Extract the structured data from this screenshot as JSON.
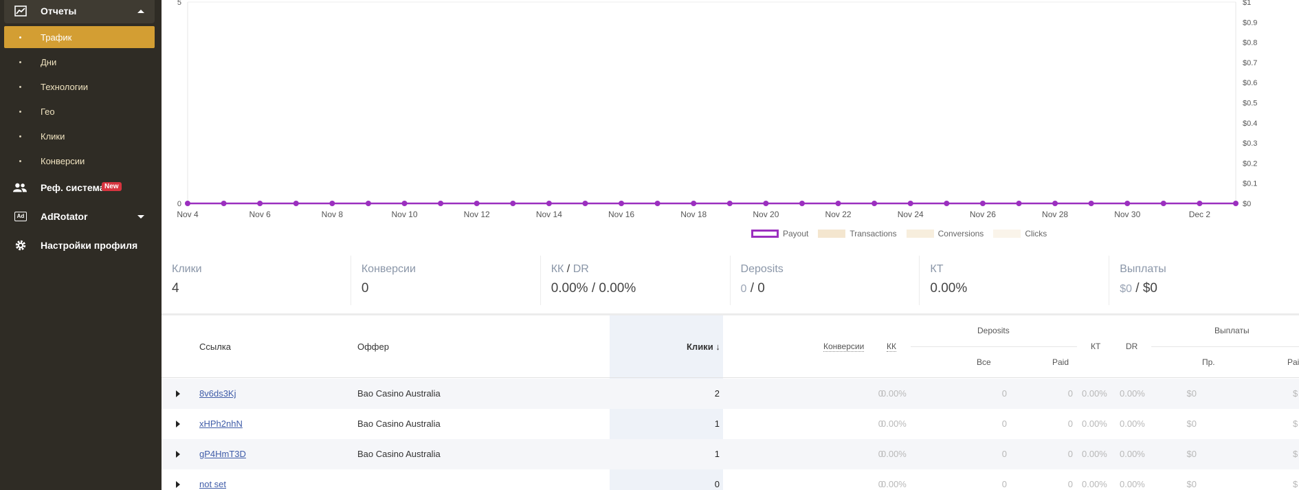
{
  "sidebar": {
    "reports_label": "Отчеты",
    "subitems": [
      "Трафик",
      "Дни",
      "Технологии",
      "Гео",
      "Клики",
      "Конверсии"
    ],
    "ref_label": "Реф. система",
    "ref_badge": "New",
    "adrotator_label": "AdRotator",
    "adrotator_icon_text": "Ad",
    "profile_label": "Настройки профиля"
  },
  "chart_data": {
    "type": "line",
    "x": [
      "Nov 4",
      "Nov 5",
      "Nov 6",
      "Nov 7",
      "Nov 8",
      "Nov 9",
      "Nov 10",
      "Nov 11",
      "Nov 12",
      "Nov 13",
      "Nov 14",
      "Nov 15",
      "Nov 16",
      "Nov 17",
      "Nov 18",
      "Nov 19",
      "Nov 20",
      "Nov 21",
      "Nov 22",
      "Nov 23",
      "Nov 24",
      "Nov 25",
      "Nov 26",
      "Nov 27",
      "Nov 28",
      "Nov 29",
      "Nov 30",
      "Dec 1",
      "Dec 2",
      "Dec 3"
    ],
    "x_tick_labels": [
      "Nov 4",
      "Nov 6",
      "Nov 8",
      "Nov 10",
      "Nov 12",
      "Nov 14",
      "Nov 16",
      "Nov 18",
      "Nov 20",
      "Nov 22",
      "Nov 24",
      "Nov 26",
      "Nov 28",
      "Nov 30",
      "Dec 2"
    ],
    "series": [
      {
        "name": "Payout",
        "values": [
          0,
          0,
          0,
          0,
          0,
          0,
          0,
          0,
          0,
          0,
          0,
          0,
          0,
          0,
          0,
          0,
          0,
          0,
          0,
          0,
          0,
          0,
          0,
          0,
          0,
          0,
          0,
          0,
          0,
          0
        ]
      },
      {
        "name": "Transactions",
        "values": [
          0,
          0,
          0,
          0,
          0,
          0,
          0,
          0,
          0,
          0,
          0,
          0,
          0,
          0,
          0,
          0,
          0,
          0,
          0,
          0,
          0,
          0,
          0,
          0,
          0,
          0,
          0,
          0,
          0,
          0
        ]
      },
      {
        "name": "Conversions",
        "values": [
          0,
          0,
          0,
          0,
          0,
          0,
          0,
          0,
          0,
          0,
          0,
          0,
          0,
          0,
          0,
          0,
          0,
          0,
          0,
          0,
          0,
          0,
          0,
          0,
          0,
          0,
          0,
          0,
          0,
          0
        ]
      },
      {
        "name": "Clicks",
        "values": [
          0,
          0,
          0,
          0,
          0,
          0,
          0,
          0,
          0,
          0,
          0,
          0,
          0,
          0,
          0,
          0,
          0,
          0,
          0,
          0,
          0,
          0,
          0,
          0,
          0,
          0,
          0,
          0,
          0,
          0
        ]
      }
    ],
    "left_axis_ticks": [
      "5",
      "0"
    ],
    "right_axis_ticks": [
      "$1",
      "$0.9",
      "$0.8",
      "$0.7",
      "$0.6",
      "$0.5",
      "$0.4",
      "$0.3",
      "$0.2",
      "$0.1",
      "$0"
    ],
    "ylim_left": [
      0,
      5
    ],
    "ylim_right": [
      0,
      1
    ],
    "legend_position": "bottom",
    "colors": {
      "payout": "#9b2fbf",
      "transactions": "#f4e6cf",
      "conversions": "#f7eedd",
      "clicks": "#faf4ea"
    }
  },
  "stats": [
    {
      "label": "Клики",
      "value": "4"
    },
    {
      "label": "Конверсии",
      "value": "0"
    },
    {
      "label_a": "КК",
      "label_sep": "/",
      "label_b": "DR",
      "value": "0.00% / 0.00%"
    },
    {
      "label": "Deposits",
      "value_muted": "0",
      "value_rest": "/ 0"
    },
    {
      "label": "КТ",
      "value": "0.00%"
    },
    {
      "label": "Выплаты",
      "value_muted": "$0",
      "value_rest": "/ $0"
    }
  ],
  "table": {
    "headers": {
      "link": "Ссылка",
      "offer": "Оффер",
      "clicks": "Клики ↓",
      "conversions": "Конверсии",
      "kk": "КК",
      "deposits": "Deposits",
      "deposits_all": "Все",
      "deposits_paid": "Paid",
      "kt": "КТ",
      "dr": "DR",
      "payouts": "Выплаты",
      "payouts_pr": "Пр.",
      "payouts_paid": "Pai"
    },
    "rows": [
      {
        "link": "8v6ds3Kj",
        "offer": "Bao Casino Australia",
        "clicks": "2",
        "conv": "0",
        "kk": "0.00%",
        "all": "0",
        "paid": "0",
        "kt": "0.00%",
        "dr": "0.00%",
        "pr": "$0",
        "pay_paid": "$"
      },
      {
        "link": "xHPh2nhN",
        "offer": "Bao Casino Australia",
        "clicks": "1",
        "conv": "0",
        "kk": "0.00%",
        "all": "0",
        "paid": "0",
        "kt": "0.00%",
        "dr": "0.00%",
        "pr": "$0",
        "pay_paid": "$"
      },
      {
        "link": "gP4HmT3D",
        "offer": "Bao Casino Australia",
        "clicks": "1",
        "conv": "0",
        "kk": "0.00%",
        "all": "0",
        "paid": "0",
        "kt": "0.00%",
        "dr": "0.00%",
        "pr": "$0",
        "pay_paid": "$"
      },
      {
        "link": "not set",
        "offer": "",
        "clicks": "0",
        "conv": "0",
        "kk": "0.00%",
        "all": "0",
        "paid": "0",
        "kt": "0.00%",
        "dr": "0.00%",
        "pr": "$0",
        "pay_paid": "$"
      }
    ]
  }
}
